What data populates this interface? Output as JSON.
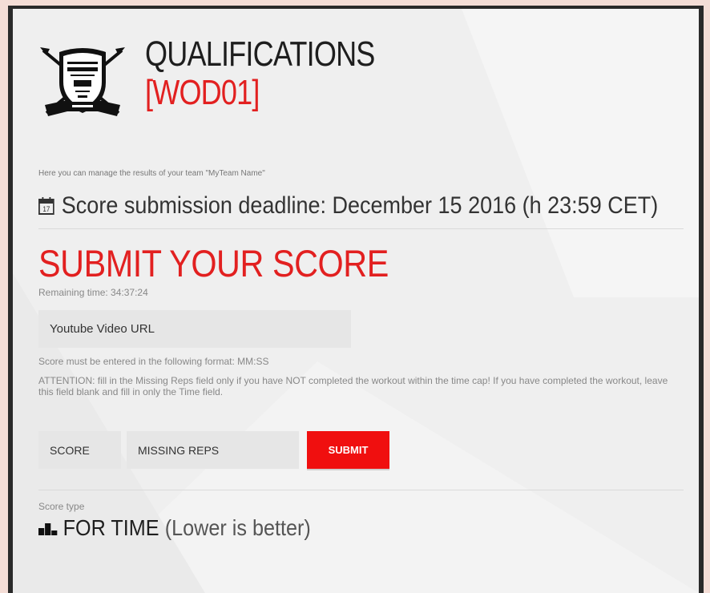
{
  "header": {
    "title": "QUALIFICATIONS",
    "subtitle": "[WOD01]",
    "logo_icon": "crest-shield-logo"
  },
  "intro_text": "Here you can manage the results of your team \"MyTeam Name\"",
  "deadline": {
    "icon": "calendar-icon",
    "calendar_day": "17",
    "text": "Score submission deadline: December 15 2016 (h 23:59 CET)"
  },
  "submit_section": {
    "heading": "SUBMIT YOUR SCORE",
    "remaining_time": "Remaining time: 34:37:24",
    "video_url_placeholder": "Youtube Video URL",
    "format_hint": "Score must be entered in the following format: MM:SS",
    "attention_text": "ATTENTION: fill in the Missing Reps field only if you have NOT completed the workout within the time cap! If you have completed the workout, leave this field blank and fill in only the Time field.",
    "score_placeholder": "SCORE",
    "missing_reps_placeholder": "MISSING REPS",
    "submit_label": "SUBMIT"
  },
  "score_type": {
    "label": "Score type",
    "icon": "podium-icon",
    "value": "FOR TIME",
    "note": "(Lower is better)"
  },
  "colors": {
    "accent": "#e22020",
    "button": "#f00f0f",
    "page_bg": "#f4ddd6",
    "panel_bg": "#efefef"
  }
}
